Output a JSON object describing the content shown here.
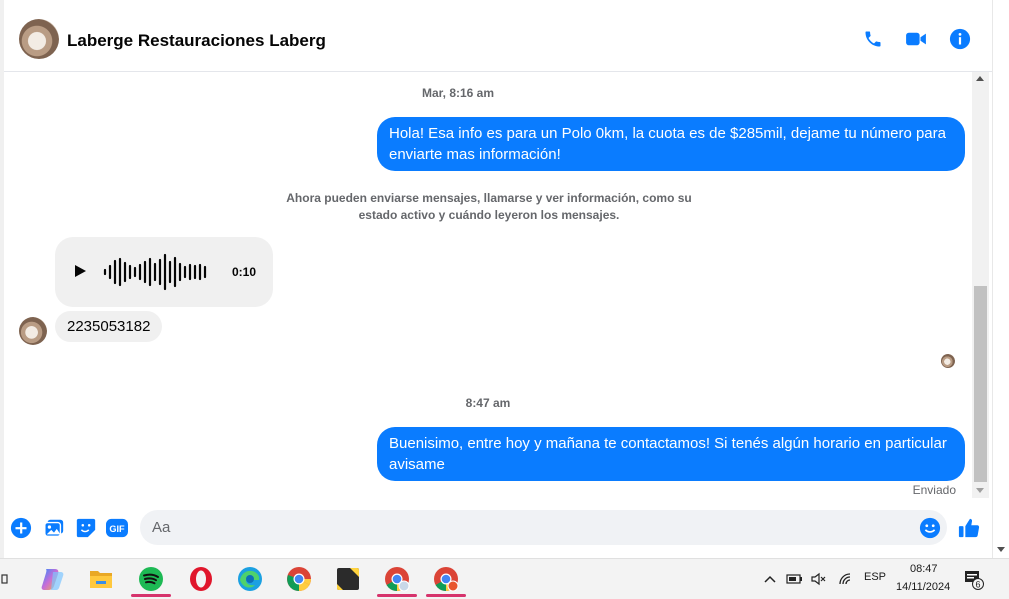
{
  "conversation": {
    "title": "Laberge Restauraciones Laberg",
    "actions": {
      "call_icon": "phone-icon",
      "video_icon": "video-camera-icon",
      "info_icon": "info-icon"
    }
  },
  "thread": {
    "timestamp_1": "Mar, 8:16 am",
    "message_out_1": "Hola! Esa info es para un Polo 0km, la cuota es de $285mil, dejame tu número para enviarte mas información!",
    "notice": "Ahora pueden enviarse mensajes, llamarse y ver información, como su estado activo y cuándo leyeron los mensajes.",
    "audio": {
      "duration": "0:10"
    },
    "message_in_1": "2235053182",
    "timestamp_2": "8:47 am",
    "message_out_2": "Buenisimo, entre hoy y mañana te contactamos! Si tenés algún horario en particular avisame",
    "status": "Enviado"
  },
  "composer": {
    "placeholder": "Aa",
    "icons": [
      "plus-icon",
      "photo-icon",
      "sticker-icon",
      "gif-icon",
      "emoji-icon",
      "like-icon"
    ],
    "gif_label": "GIF"
  },
  "taskbar": {
    "apps": [
      "copilot",
      "file-explorer",
      "spotify",
      "opera",
      "edge",
      "chrome",
      "sticky-notes",
      "chrome-profile",
      "chrome-profile-2"
    ],
    "language": "ESP",
    "time": "08:47",
    "date": "14/11/2024",
    "notification_count": "6"
  },
  "colors": {
    "accent": "#0a7cff",
    "bubble_in": "#f0f0f0",
    "muted_text": "#65676b",
    "taskbar_underline": "#d6336c"
  }
}
